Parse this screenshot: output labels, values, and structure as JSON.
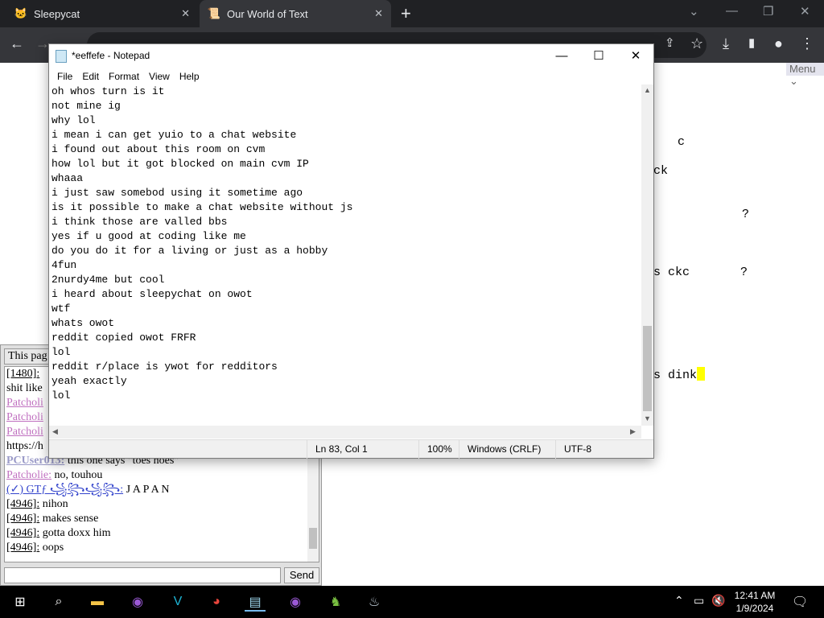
{
  "browser": {
    "tabs": [
      {
        "title": "Sleepycat",
        "icon": "cat-icon"
      },
      {
        "title": "Our World of Text",
        "icon": "owot-icon"
      }
    ],
    "url_partial": "..."
  },
  "owot": {
    "menu_label": "Menu",
    "canvas_lines": [
      {
        "text": "c"
      },
      {
        "text": "ck"
      },
      {
        "text": "?"
      },
      {
        "text": "s ckc       ?"
      },
      {
        "text": "s dink"
      }
    ]
  },
  "chat": {
    "tab_label": "This pag",
    "messages": [
      {
        "nick": "[1480]:",
        "type": "num",
        "text": ""
      },
      {
        "nick": "",
        "type": "none",
        "text": "shit like"
      },
      {
        "nick": "Patcholi",
        "type": "pat",
        "text": ""
      },
      {
        "nick": "Patcholi",
        "type": "pat",
        "text": ""
      },
      {
        "nick": "Patcholi",
        "type": "pat",
        "text": ""
      },
      {
        "nick": "",
        "type": "none",
        "text": "https://h"
      },
      {
        "nick": "PCUser013:",
        "type": "reg",
        "text": " this one says \"toes hoes\""
      },
      {
        "nick": "Patcholie:",
        "type": "pat",
        "text": " no, touhou"
      },
      {
        "nick": "(✓) GTƒ ꧁꧂꧁꧂:",
        "type": "gtf",
        "text": " J A P A N"
      },
      {
        "nick": "[4946]:",
        "type": "num",
        "text": " nihon"
      },
      {
        "nick": "[4946]:",
        "type": "num",
        "text": " makes sense"
      },
      {
        "nick": "[4946]:",
        "type": "num",
        "text": " gotta doxx him"
      },
      {
        "nick": "[4946]:",
        "type": "num",
        "text": " oops"
      }
    ],
    "send_label": "Send"
  },
  "notepad": {
    "title": "*eeffefe - Notepad",
    "menu": [
      "File",
      "Edit",
      "Format",
      "View",
      "Help"
    ],
    "lines": [
      "oh whos turn is it",
      "not mine ig",
      "why lol",
      "i mean i can get yuio to a chat website",
      "i found out about this room on cvm",
      "how lol but it got blocked on main cvm IP",
      "whaaa",
      "i just saw somebod using it sometime ago",
      "is it possible to make a chat website without js",
      "i think those are valled bbs",
      "yes if u good at coding like me",
      "do you do it for a living or just as a hobby",
      "4fun",
      "2nurdy4me but cool",
      "i heard about sleepychat on owot",
      "wtf",
      "whats owot",
      "reddit copied owot FRFR",
      "lol",
      "reddit r/place is ywot for redditors",
      "yeah exactly",
      "lol"
    ],
    "status": {
      "position": "Ln 83, Col 1",
      "zoom": "100%",
      "line_endings": "Windows (CRLF)",
      "encoding": "UTF-8"
    }
  },
  "taskbar": {
    "time": "12:41 AM",
    "date": "1/9/2024",
    "apps": [
      "start-icon",
      "search-icon",
      "file-explorer-icon",
      "tor-icon",
      "vim-icon",
      "chrome-icon",
      "notepad-icon",
      "tor-icon-2",
      "game-icon",
      "steam-icon"
    ]
  }
}
